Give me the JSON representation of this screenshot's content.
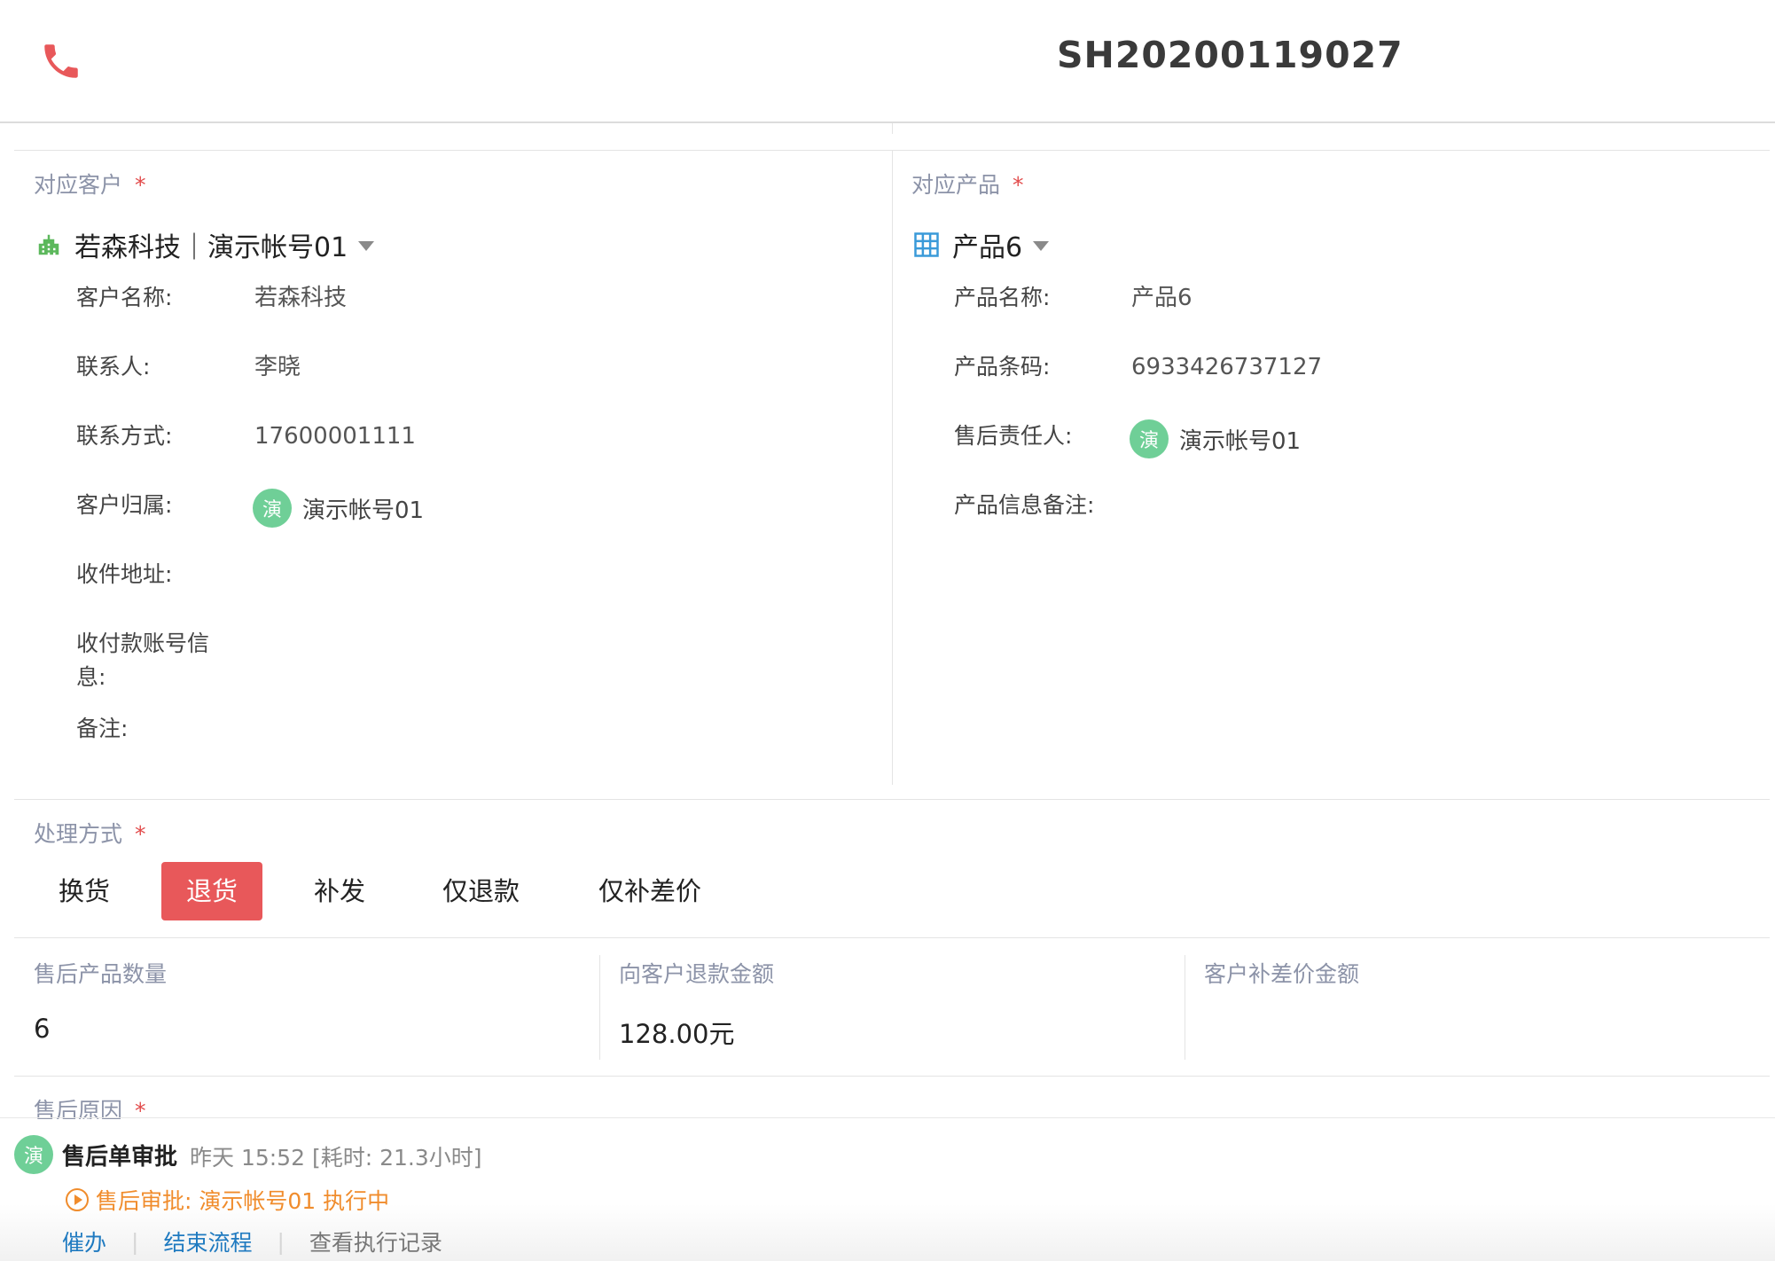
{
  "header": {
    "order_no": "SH20200119027"
  },
  "customer": {
    "section_label": "对应客户",
    "required_mark": "*",
    "selected": "若森科技｜演示帐号01",
    "fields": [
      {
        "label": "客户名称:",
        "value": "若森科技"
      },
      {
        "label": "联系人:",
        "value": "李晓"
      },
      {
        "label": "联系方式:",
        "value": "17600001111"
      },
      {
        "label": "客户归属:",
        "avatar": "演",
        "value": "演示帐号01"
      },
      {
        "label": "收件地址:",
        "value": ""
      },
      {
        "label": "收付款账号信息:",
        "value": ""
      },
      {
        "label": "备注:",
        "value": ""
      }
    ]
  },
  "product": {
    "section_label": "对应产品",
    "required_mark": "*",
    "selected": "产品6",
    "fields": [
      {
        "label": "产品名称:",
        "value": "产品6"
      },
      {
        "label": "产品条码:",
        "value": "6933426737127"
      },
      {
        "label": "售后责任人:",
        "avatar": "演",
        "value": "演示帐号01"
      },
      {
        "label": "产品信息备注:",
        "value": ""
      }
    ]
  },
  "handling": {
    "section_label": "处理方式",
    "required_mark": "*",
    "options": [
      "换货",
      "退货",
      "补发",
      "仅退款",
      "仅补差价"
    ],
    "active_index": 1
  },
  "metrics": [
    {
      "label": "售后产品数量",
      "value": "6"
    },
    {
      "label": "向客户退款金额",
      "value": "128.00元"
    },
    {
      "label": "客户补差价金额",
      "value": ""
    }
  ],
  "reason": {
    "section_label": "售后原因",
    "required_mark": "*"
  },
  "approval": {
    "avatar": "演",
    "title": "售后单审批",
    "time": "昨天 15:52 [耗时: 21.3小时]",
    "status": "售后审批: 演示帐号01 执行中",
    "actions": [
      "催办",
      "结束流程",
      "查看执行记录"
    ],
    "sep": "|"
  },
  "colors": {
    "accent_red": "#e8585a",
    "label_gray": "#8c93a8",
    "avatar_green": "#6fcf97",
    "status_orange": "#f08c2c",
    "link_blue": "#1f7ac0"
  }
}
